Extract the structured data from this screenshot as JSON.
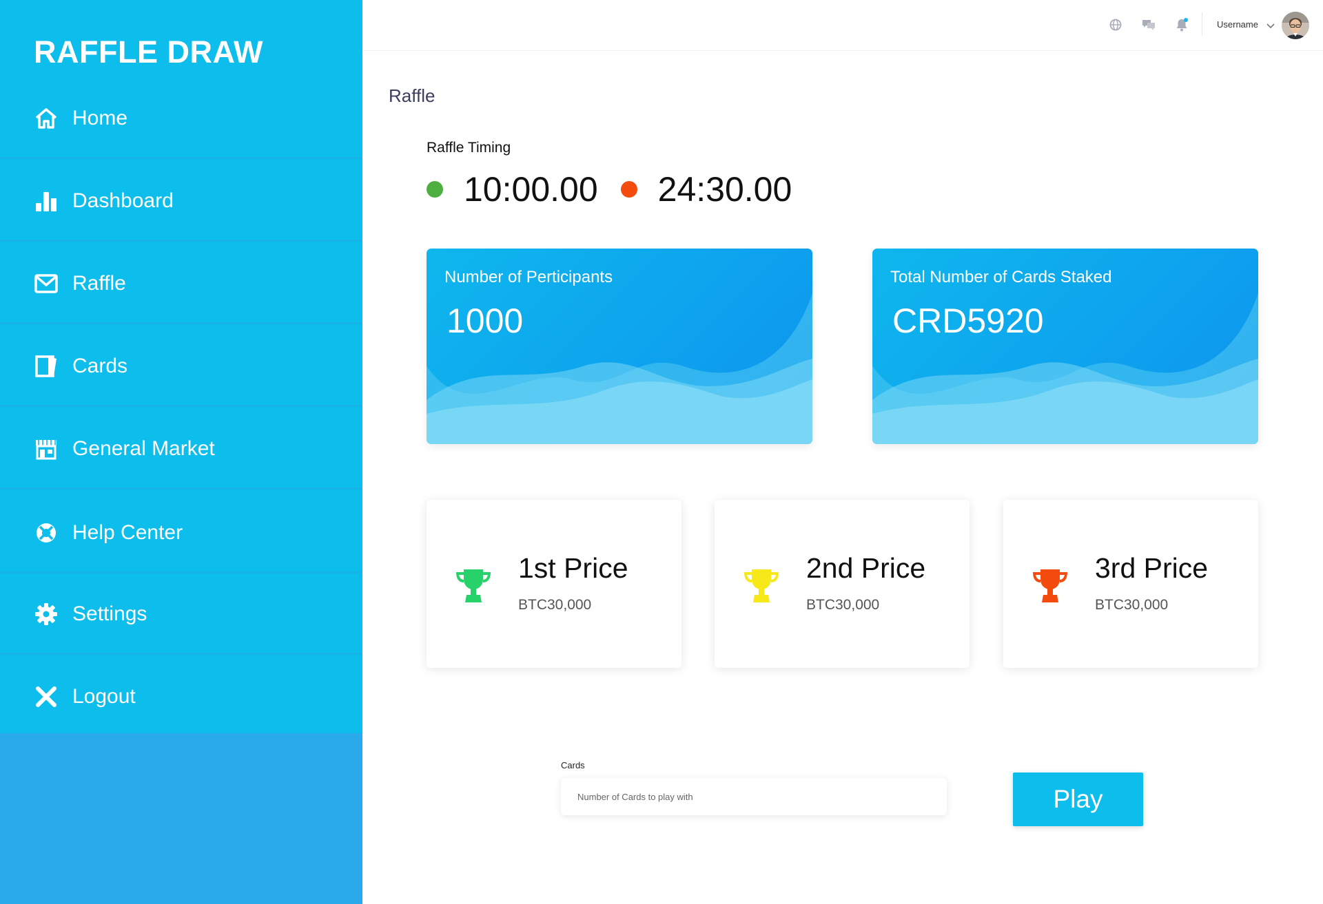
{
  "brand": "RAFFLE DRAW",
  "sidebar": {
    "items": [
      {
        "label": "Home",
        "icon": "home-icon"
      },
      {
        "label": "Dashboard",
        "icon": "bar-chart-icon"
      },
      {
        "label": "Raffle",
        "icon": "envelope-icon"
      },
      {
        "label": "Cards",
        "icon": "card-icon"
      },
      {
        "label": "General Market",
        "icon": "store-icon"
      },
      {
        "label": "Help Center",
        "icon": "lifebuoy-icon"
      },
      {
        "label": "Settings",
        "icon": "gear-icon"
      },
      {
        "label": "Logout",
        "icon": "close-icon"
      }
    ]
  },
  "header": {
    "icons": [
      "globe-icon",
      "chat-icon",
      "bell-icon"
    ],
    "username": "Username",
    "notification_dot_color": "#1db4ea"
  },
  "page": {
    "title": "Raffle",
    "timing_label": "Raffle Timing",
    "start_time": "10:00.00",
    "end_time": "24:30.00",
    "start_dot_color": "#4caf3f",
    "end_dot_color": "#f44b0f"
  },
  "stats": [
    {
      "title": "Number of Perticipants",
      "value": "1000"
    },
    {
      "title": "Total Number of Cards Staked",
      "value": "CRD5920"
    }
  ],
  "prizes": [
    {
      "title": "1st Price",
      "amount": "BTC30,000",
      "color": "#27d26a"
    },
    {
      "title": "2nd Price",
      "amount": "BTC30,000",
      "color": "#f7e81a"
    },
    {
      "title": "3rd Price",
      "amount": "BTC30,000",
      "color": "#f44b0f"
    }
  ],
  "form": {
    "label": "Cards",
    "placeholder": "Number of Cards to play with",
    "play_label": "Play"
  },
  "colors": {
    "sidebar": "#0dbdec",
    "sidebar_bottom": "#2aaaea",
    "accent": "#0dbdec"
  }
}
